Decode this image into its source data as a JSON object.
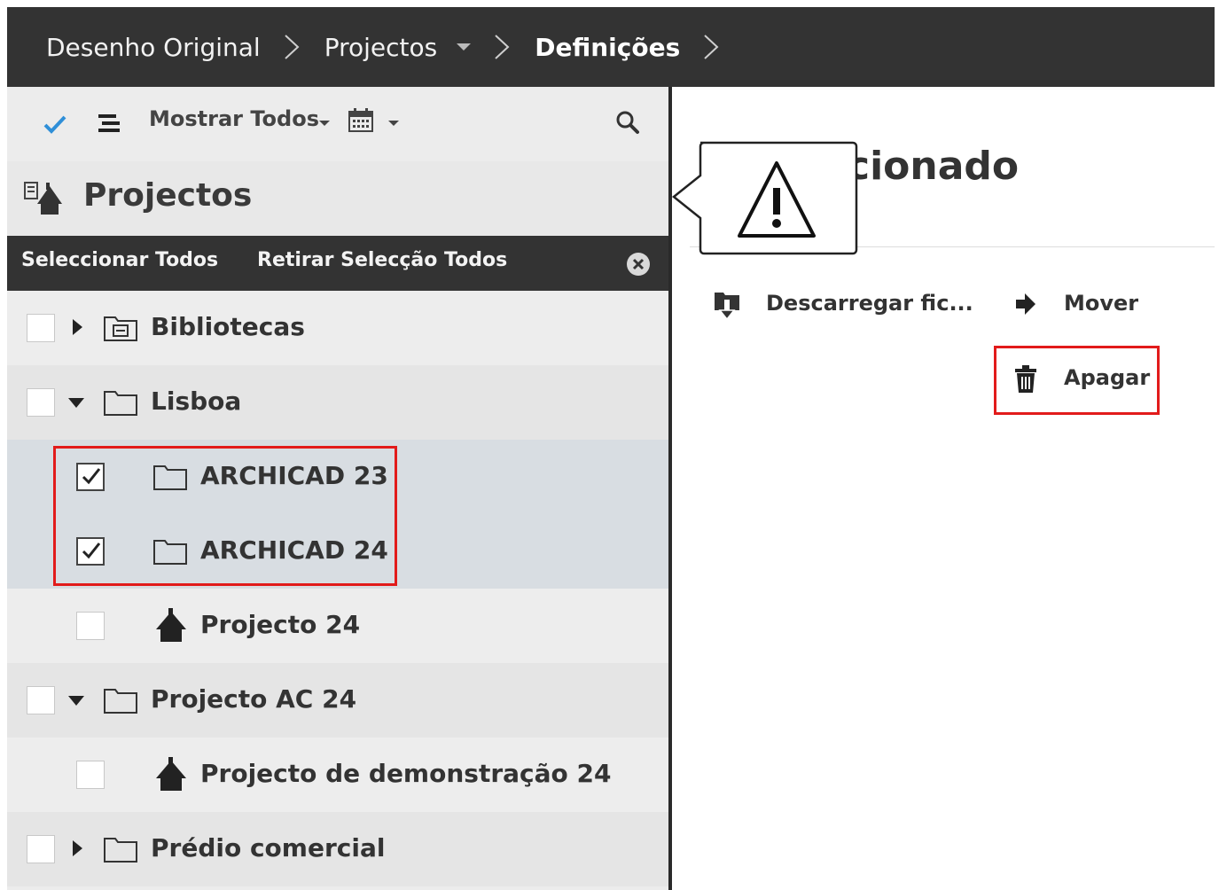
{
  "breadcrumb": {
    "items": [
      {
        "label": "Desenho Original"
      },
      {
        "label": "Projectos"
      },
      {
        "label": "Definições"
      }
    ]
  },
  "toolbar": {
    "filter_label": "Mostrar Todos"
  },
  "projects_panel": {
    "title": "Projectos",
    "select_all": "Seleccionar Todos",
    "deselect_all": "Retirar Selecção Todos"
  },
  "tree": [
    {
      "label": "Bibliotecas",
      "checked": false,
      "expand": "collapsed",
      "icon": "library-folder-icon"
    },
    {
      "label": "Lisboa",
      "checked": false,
      "expand": "expanded",
      "icon": "folder-icon"
    },
    {
      "label": "ARCHICAD 23",
      "checked": true,
      "expand": "none",
      "icon": "folder-icon"
    },
    {
      "label": "ARCHICAD 24",
      "checked": true,
      "expand": "none",
      "icon": "folder-icon"
    },
    {
      "label": "Projecto 24",
      "checked": false,
      "expand": "none",
      "icon": "project-icon"
    },
    {
      "label": "Projecto AC 24",
      "checked": false,
      "expand": "expanded",
      "icon": "folder-icon"
    },
    {
      "label": "Projecto de demonstração 24",
      "checked": false,
      "expand": "none",
      "icon": "project-icon"
    },
    {
      "label": "Prédio comercial",
      "checked": false,
      "expand": "collapsed",
      "icon": "folder-icon"
    }
  ],
  "details": {
    "title_partial": "cionado",
    "actions": [
      {
        "label": "Descarregar fic...",
        "icon": "download-icon"
      },
      {
        "label": "Mover",
        "icon": "arrow-right-icon"
      },
      {
        "label": "Apagar",
        "icon": "trash-icon"
      }
    ]
  },
  "colors": {
    "topbar": "#333333",
    "highlight": "#e21b1b",
    "check_accent": "#2f8fd8"
  }
}
